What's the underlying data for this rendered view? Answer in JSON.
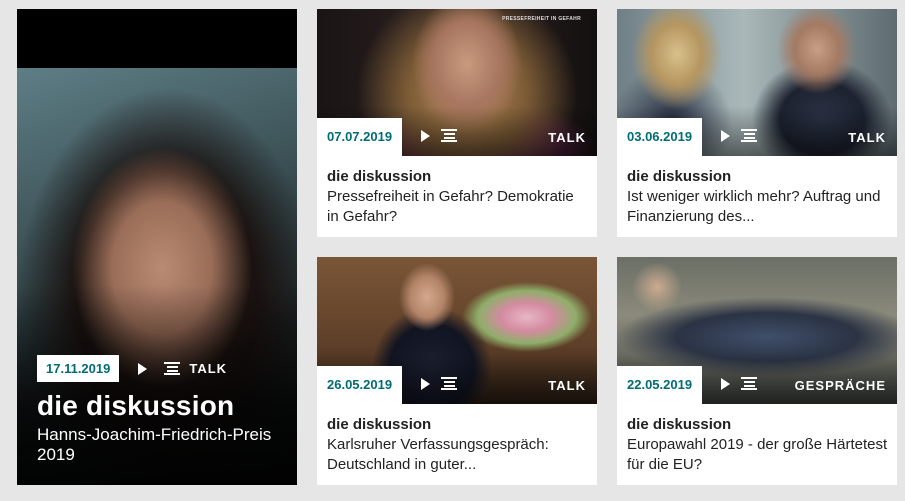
{
  "featured": {
    "date": "17.11.2019",
    "category": "TALK",
    "title": "die diskussion",
    "subtitle": "Hanns-Joachim-Friedrich-Preis 2019"
  },
  "cards": [
    {
      "date": "07.07.2019",
      "category": "TALK",
      "title": "die diskussion",
      "text": "Pressefreiheit in Gefahr? Demokratie in Gefahr?",
      "thumb_overlay_text": "PRESSEFREIHEIT IN GEFAHR"
    },
    {
      "date": "03.06.2019",
      "category": "TALK",
      "title": "die diskussion",
      "text": "Ist weniger wirklich mehr? Auftrag und Finanzierung des..."
    },
    {
      "date": "26.05.2019",
      "category": "TALK",
      "title": "die diskussion",
      "text": "Karlsruher Verfassungsgespräch: Deutschland in guter..."
    },
    {
      "date": "22.05.2019",
      "category": "GESPRÄCHE",
      "title": "die diskussion",
      "text": "Europawahl 2019 - der große Härtetest für die EU?"
    }
  ],
  "icons": {
    "play": "play-icon",
    "list": "playlist-icon"
  },
  "colors": {
    "date_text": "#006d73",
    "background": "#e6e6e6"
  }
}
